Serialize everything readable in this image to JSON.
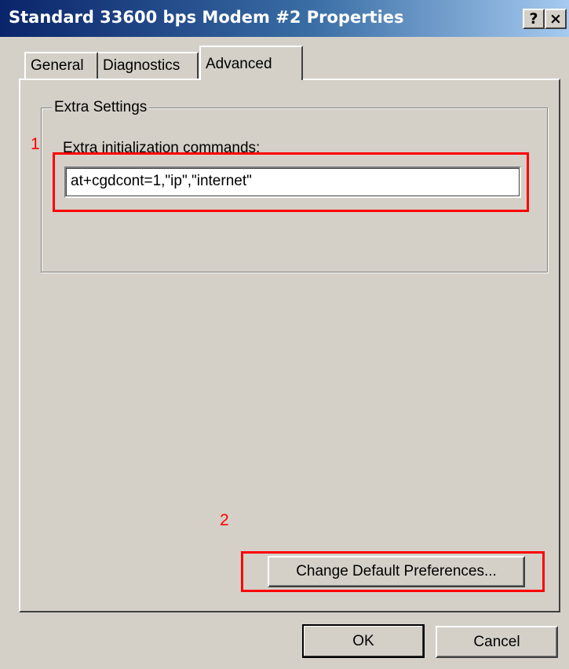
{
  "window": {
    "title": "Standard 33600 bps Modem #2 Properties",
    "help_button": "?",
    "close_button": "×"
  },
  "tabs": [
    {
      "label": "General",
      "active": false
    },
    {
      "label": "Diagnostics",
      "active": false
    },
    {
      "label": "Advanced",
      "active": true
    }
  ],
  "extra_settings": {
    "group_label": "Extra Settings",
    "field_label": "Extra initialization commands:",
    "field_value": "at+cgdcont=1,\"ip\",\"internet\""
  },
  "annotations": [
    {
      "number": "1",
      "color": "#ff0000"
    },
    {
      "number": "2",
      "color": "#ff0000"
    }
  ],
  "buttons": {
    "change_defaults": "Change Default Preferences...",
    "ok": "OK",
    "cancel": "Cancel"
  },
  "colors": {
    "title_gradient_start": "#0a246a",
    "title_gradient_end": "#a6caf0",
    "dialog_background": "#d4d0c8",
    "annotation": "#ff0000"
  }
}
